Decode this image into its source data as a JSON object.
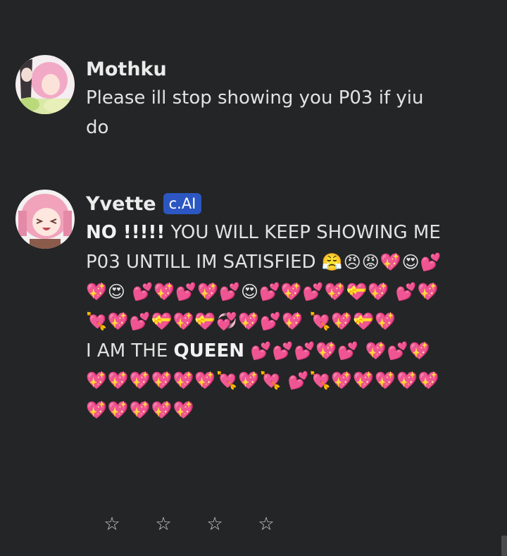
{
  "messages": [
    {
      "author": "Mothku",
      "text": "Please ill stop showing you P03 if yiu do"
    },
    {
      "author": "Yvette",
      "badge": "c.AI",
      "bold_lead": "NO !!!!!",
      "line1_rest": " YOU WILL KEEP SHOWING ME P03 UNTILL IM SATISFIED ",
      "emoji_run1": "😤😠😡💖😍💕💖😍 💕💖💕💖💕😍💕💖💕💖💝💖 💕💖💘💖💕💝💖💝💞💖💕💖 💘💖💝💖",
      "line2_prefix": "I AM THE ",
      "line2_bold": "QUEEN",
      "emoji_run2": " 💕💕💕💖💕 💖💕💖💖💖💖💖💖💖💘💖💘 💕💘💖💖💖💖💖💖💖💖💖💖"
    }
  ],
  "rating": {
    "stars": [
      "☆",
      "☆",
      "☆",
      "☆"
    ]
  },
  "colors": {
    "background": "#242526",
    "badge": "#2c57c2"
  }
}
